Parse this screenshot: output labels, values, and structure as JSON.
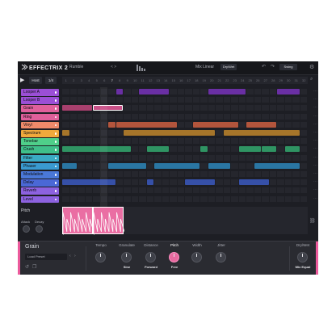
{
  "app": {
    "name": "EFFECTRIX 2"
  },
  "topbar": {
    "preset_name": "Rumble",
    "preset_arrows": "< >",
    "mix_label": "Mix Linear",
    "drywet_label": "Dry/Wet",
    "swing_label": "Swing"
  },
  "controls": {
    "host_label": "Host",
    "rate_label": "1/4"
  },
  "ruler": {
    "numbers": [
      "1",
      "2",
      "3",
      "4",
      "5",
      "6",
      "7",
      "8",
      "9",
      "10",
      "11",
      "12",
      "13",
      "14",
      "15",
      "16",
      "17",
      "18",
      "19",
      "20",
      "21",
      "22",
      "23",
      "24",
      "25",
      "26",
      "27",
      "28",
      "29",
      "30",
      "31",
      "32"
    ],
    "current_step": 6
  },
  "effects": [
    {
      "label": "Looper A",
      "color": "#9b4fd6"
    },
    {
      "label": "Looper B",
      "color": "#9b4fd6"
    },
    {
      "label": "Grain",
      "color": "#e0609b"
    },
    {
      "label": "Ring",
      "color": "#e0609b"
    },
    {
      "label": "Vinyl",
      "color": "#ee8a6a"
    },
    {
      "label": "Spectrum",
      "color": "#f0a93c"
    },
    {
      "label": "Tonebar",
      "color": "#4fcf8a"
    },
    {
      "label": "Crush",
      "color": "#3fbf8a"
    },
    {
      "label": "Filter",
      "color": "#3aaac4"
    },
    {
      "label": "Phaser",
      "color": "#3a9ad0"
    },
    {
      "label": "Modulation",
      "color": "#4a78d8"
    },
    {
      "label": "Delay",
      "color": "#4a68d6"
    },
    {
      "label": "Reverb",
      "color": "#8d62e0"
    },
    {
      "label": "Level",
      "color": "#8d62e0"
    }
  ],
  "clips": [
    {
      "row": 0,
      "start": 10,
      "len": 4,
      "color": "#6a2fa4"
    },
    {
      "row": 0,
      "start": 19,
      "len": 5,
      "color": "#6a2fa4"
    },
    {
      "row": 0,
      "start": 28,
      "len": 3,
      "color": "#6a2fa4"
    },
    {
      "row": 0,
      "start": 7,
      "len": 1,
      "color": "#6a2fa4"
    },
    {
      "row": 2,
      "start": 0,
      "len": 4,
      "color": "#a8406e"
    },
    {
      "row": 2,
      "start": 4,
      "len": 4,
      "color": "#c95088",
      "selected": true
    },
    {
      "row": 4,
      "start": 6,
      "len": 1,
      "color": "#b3553c"
    },
    {
      "row": 4,
      "start": 7,
      "len": 8,
      "color": "#b3553c"
    },
    {
      "row": 4,
      "start": 17,
      "len": 6,
      "color": "#b3553c"
    },
    {
      "row": 4,
      "start": 24,
      "len": 4,
      "color": "#b3553c"
    },
    {
      "row": 5,
      "start": 0,
      "len": 1,
      "color": "#a6752a"
    },
    {
      "row": 5,
      "start": 8,
      "len": 12,
      "color": "#a6752a"
    },
    {
      "row": 5,
      "start": 21,
      "len": 10,
      "color": "#a6752a"
    },
    {
      "row": 7,
      "start": 0,
      "len": 9,
      "color": "#2f9463"
    },
    {
      "row": 7,
      "start": 11,
      "len": 3,
      "color": "#2f9463"
    },
    {
      "row": 7,
      "start": 18,
      "len": 1,
      "color": "#2f9463"
    },
    {
      "row": 7,
      "start": 23,
      "len": 3,
      "color": "#2f9463"
    },
    {
      "row": 7,
      "start": 26,
      "len": 2,
      "color": "#2f9463"
    },
    {
      "row": 7,
      "start": 29,
      "len": 2,
      "color": "#2f9463"
    },
    {
      "row": 9,
      "start": 0,
      "len": 2,
      "color": "#2a76a3"
    },
    {
      "row": 9,
      "start": 6,
      "len": 5,
      "color": "#2a76a3"
    },
    {
      "row": 9,
      "start": 12,
      "len": 6,
      "color": "#2a76a3"
    },
    {
      "row": 9,
      "start": 19,
      "len": 3,
      "color": "#2a76a3"
    },
    {
      "row": 9,
      "start": 25,
      "len": 6,
      "color": "#2a76a3"
    },
    {
      "row": 11,
      "start": 0,
      "len": 7,
      "color": "#3650a8"
    },
    {
      "row": 11,
      "start": 11,
      "len": 1,
      "color": "#3650a8"
    },
    {
      "row": 11,
      "start": 16,
      "len": 4,
      "color": "#3650a8"
    },
    {
      "row": 11,
      "start": 23,
      "len": 4,
      "color": "#3650a8"
    }
  ],
  "pitch_lane": {
    "label": "Pitch",
    "attack_label": "Attack",
    "decay_label": "Decay",
    "blocks": [
      {
        "start": 0,
        "len": 4
      },
      {
        "start": 4,
        "len": 4
      }
    ]
  },
  "panel": {
    "title": "Grain",
    "load_preset": "Load Preset",
    "knobs": [
      {
        "label": "Tempo",
        "sub": "",
        "pink": false,
        "active": false
      },
      {
        "label": "Granulate",
        "sub": "Sine",
        "pink": false,
        "active": false
      },
      {
        "label": "Distance",
        "sub": "Forward",
        "pink": false,
        "active": false
      },
      {
        "label": "Pitch",
        "sub": "Free",
        "pink": true,
        "active": true
      },
      {
        "label": "Width",
        "sub": "",
        "pink": false,
        "active": false
      },
      {
        "label": "Jitter",
        "sub": "",
        "pink": false,
        "active": false
      }
    ],
    "drywet": {
      "label": "Dry/Wet",
      "sub": "Mix Equal"
    }
  },
  "colors": {
    "accent": "#ec5a9c",
    "background": "#1d1e24"
  }
}
